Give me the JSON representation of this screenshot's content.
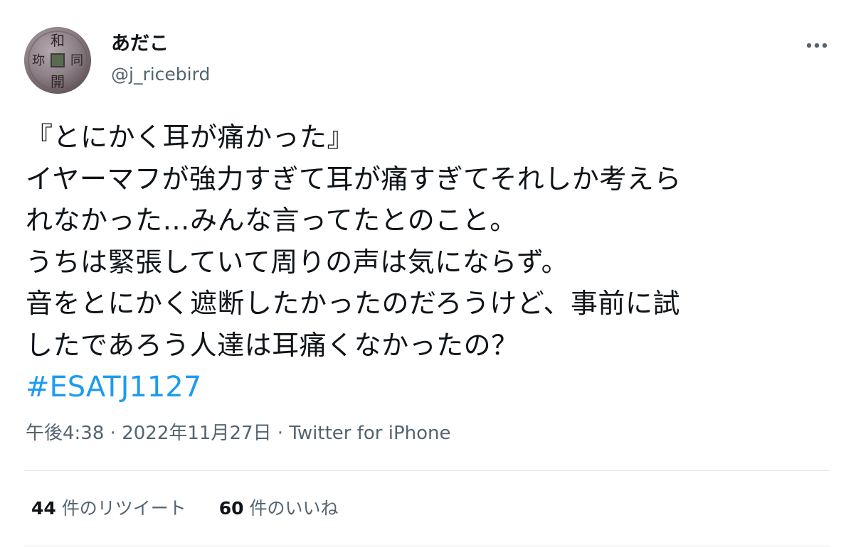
{
  "user": {
    "display_name": "あだこ",
    "handle": "@j_ricebird",
    "avatar_glyphs": [
      "和",
      "同",
      "開",
      "珎"
    ]
  },
  "tweet": {
    "lines": [
      "『とにかく耳が痛かった』",
      "イヤーマフが強力すぎて耳が痛すぎてそれしか考えら",
      "れなかった…みんな言ってたとのこと。",
      "うちは緊張していて周りの声は気にならず。",
      "音をとにかく遮断したかったのだろうけど、事前に試",
      "したであろう人達は耳痛くなかったの？"
    ],
    "hashtag": "#ESATJ1127"
  },
  "meta": {
    "time": "午後4:38",
    "date": "2022年11月27日",
    "separator": "·",
    "source": "Twitter for iPhone"
  },
  "stats": {
    "retweets_count": "44",
    "retweets_label": "件のリツイート",
    "likes_count": "60",
    "likes_label": "件のいいね"
  },
  "icons": {
    "more": "more-horizontal-icon"
  },
  "colors": {
    "text": "#0f1419",
    "secondary": "#536471",
    "link": "#1d9bf0",
    "divider": "#e4e9ec"
  }
}
